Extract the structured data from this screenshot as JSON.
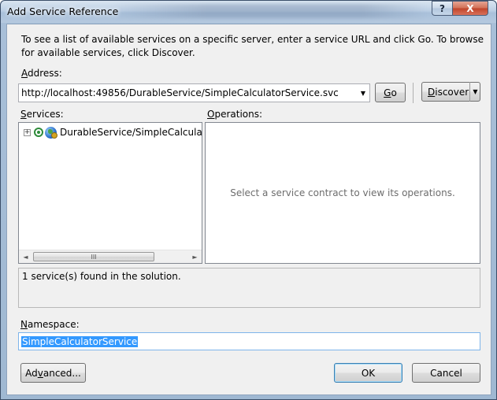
{
  "window": {
    "title": "Add Service Reference",
    "help_glyph": "?",
    "close_glyph": "X"
  },
  "intro_text": "To see a list of available services on a specific server, enter a service URL and click Go. To browse for available services, click Discover.",
  "address": {
    "label_mnemonic": "A",
    "label_rest": "ddress:",
    "value": "http://localhost:49856/DurableService/SimpleCalculatorService.svc",
    "go_mnemonic": "G",
    "go_rest": "o",
    "discover_mnemonic": "D",
    "discover_rest": "iscover"
  },
  "services": {
    "label_mnemonic": "S",
    "label_rest": "ervices:",
    "items": [
      {
        "label": "DurableService/SimpleCalculatorService",
        "expander": "+"
      }
    ],
    "scroll_grip": "III"
  },
  "operations": {
    "label_mnemonic": "O",
    "label_rest": "perations:",
    "empty_message": "Select a service contract to view its operations."
  },
  "status_text": "1 service(s) found in the solution.",
  "namespace": {
    "label_mnemonic": "N",
    "label_rest": "amespace:",
    "value": "SimpleCalculatorService"
  },
  "buttons": {
    "advanced_pre": "Ad",
    "advanced_mnemonic": "v",
    "advanced_post": "anced...",
    "ok": "OK",
    "cancel": "Cancel"
  }
}
